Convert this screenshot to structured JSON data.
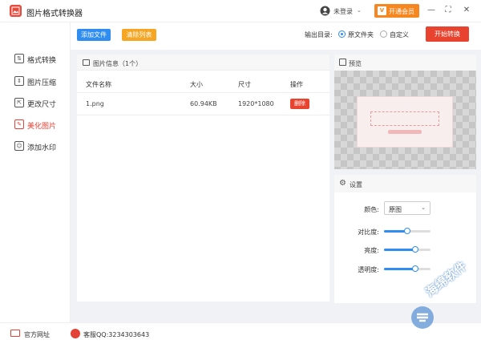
{
  "app": {
    "title": "图片格式转换器",
    "login": "未登录",
    "vip": "开通会员",
    "window_controls": [
      "minimize-icon",
      "maximize-icon",
      "close-icon"
    ]
  },
  "sidebar": {
    "items": [
      {
        "label": "格式转换",
        "icon": "convert-icon",
        "active": false
      },
      {
        "label": "图片压缩",
        "icon": "compress-icon",
        "active": false
      },
      {
        "label": "更改尺寸",
        "icon": "resize-icon",
        "active": false
      },
      {
        "label": "美化图片",
        "icon": "beautify-icon",
        "active": true
      },
      {
        "label": "添加水印",
        "icon": "watermark-icon",
        "active": false
      }
    ]
  },
  "toolbar": {
    "add_files": "添加文件",
    "clear_list": "清除列表",
    "output_label": "输出目录:",
    "output_options": [
      "原文件夹",
      "自定义"
    ],
    "selected_output": "原文件夹",
    "start": "开始转换"
  },
  "file_panel": {
    "title": "图片信息（1个）",
    "columns": [
      "文件名称",
      "大小",
      "尺寸",
      "操作"
    ],
    "rows": [
      {
        "name": "1.png",
        "size": "60.94KB",
        "dimensions": "1920*1080",
        "action": "删除"
      }
    ]
  },
  "preview": {
    "title": "预览"
  },
  "settings": {
    "title": "设置",
    "color_label": "颜色:",
    "color_value": "原图",
    "contrast_label": "对比度:",
    "contrast_value": 0.5,
    "brightness_label": "亮度:",
    "brightness_value": 0.68,
    "opacity_label": "透明度:",
    "opacity_value": 0.68
  },
  "footer": {
    "website": "官方网址",
    "support": "客服QQ:3234303643"
  },
  "watermark": "海绵软件",
  "colors": {
    "accent_blue": "#2f8cf0",
    "accent_red": "#e8432f",
    "accent_orange": "#f6a623",
    "vip_orange": "#f6861f"
  }
}
